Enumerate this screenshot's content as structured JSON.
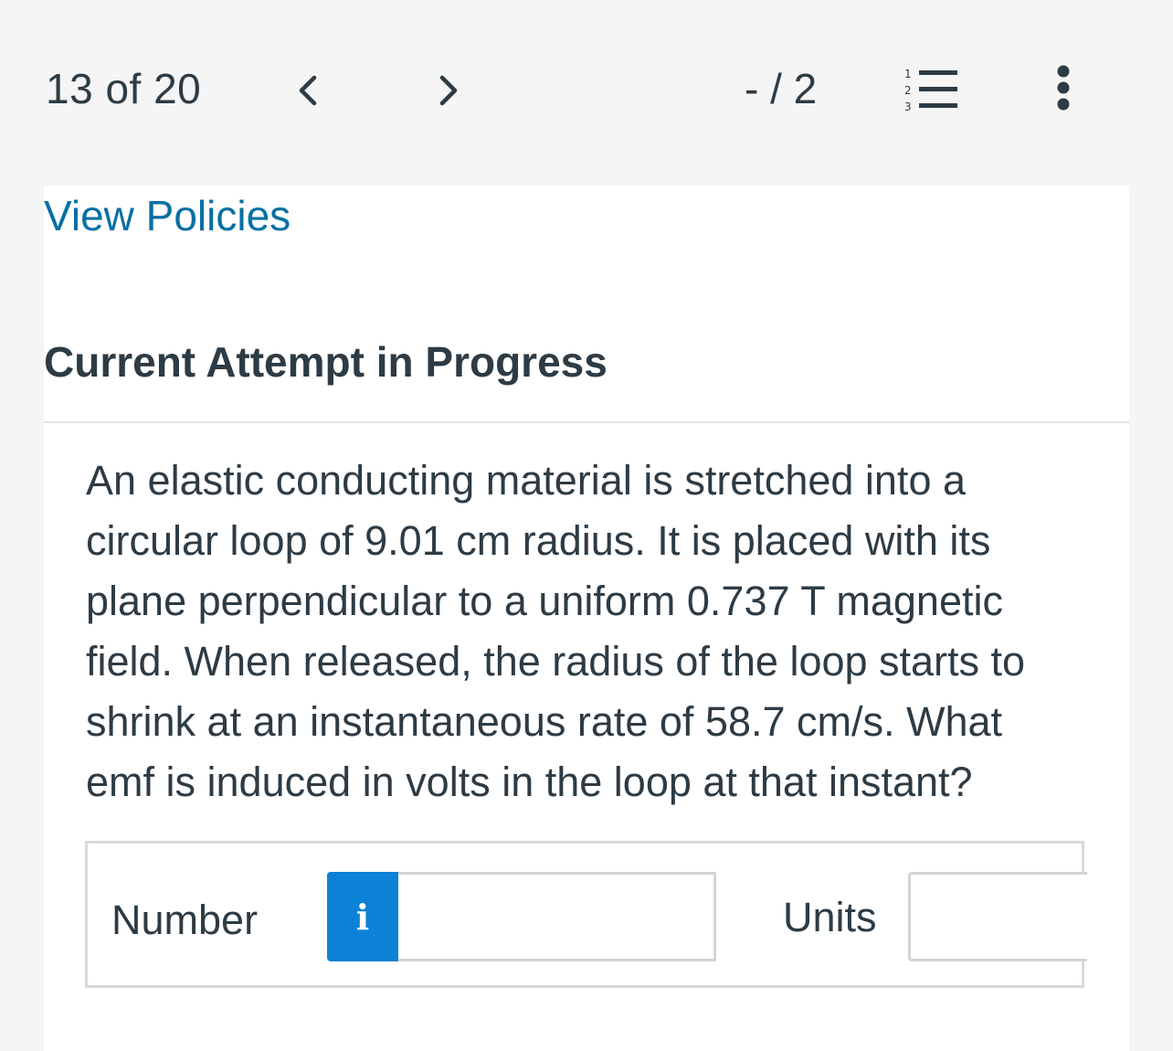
{
  "header": {
    "counter": "13 of 20",
    "score": "- / 2",
    "icons": {
      "prev": "chevron-left-icon",
      "next": "chevron-right-icon",
      "list": "numbered-list-icon",
      "more": "more-vertical-icon"
    }
  },
  "content": {
    "policies_link": "View Policies",
    "attempt_heading": "Current Attempt in Progress",
    "question_text": "An elastic conducting material is stretched into a circular loop of 9.01 cm radius. It is placed with its plane perpendicular to a uniform 0.737 T magnetic field. When released, the radius of the loop starts to shrink at an instantaneous rate of 58.7 cm/s. What emf is induced in volts in the loop at that instant?"
  },
  "answer": {
    "number_label": "Number",
    "info_glyph": "i",
    "number_value": "",
    "units_label": "Units",
    "units_value": ""
  },
  "colors": {
    "link": "#0770a3",
    "info_button": "#0b82d6",
    "text": "#2d3b45"
  }
}
